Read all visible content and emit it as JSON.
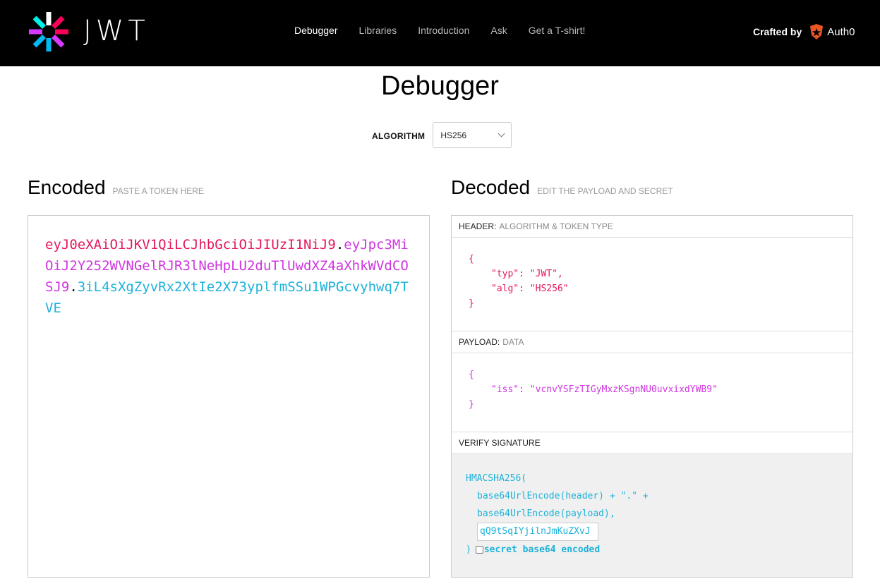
{
  "brand": {
    "logo_text": "JWT"
  },
  "nav": {
    "items": [
      {
        "label": "Debugger",
        "active": true
      },
      {
        "label": "Libraries"
      },
      {
        "label": "Introduction"
      },
      {
        "label": "Ask"
      },
      {
        "label": "Get a T-shirt!"
      }
    ]
  },
  "crafted": {
    "label": "Crafted by",
    "brand": "Auth0",
    "icon": "auth0-shield-icon"
  },
  "page": {
    "title": "Debugger"
  },
  "algorithm": {
    "label": "ALGORITHM",
    "value": "HS256"
  },
  "encoded": {
    "title": "Encoded",
    "subtitle": "PASTE A TOKEN HERE",
    "token_header": "eyJ0eXAiOiJKV1QiLCJhbGciOiJIUzI1NiJ9",
    "token_payload": "eyJpc3MiOiJ2Y252WVNGelRJR3lNeHpLU2duTlUwdXZ4aXhkWVdCOSJ9",
    "token_signature": "3iL4sXgZyvRx2XtIe2X73yplfmSSu1WPGcvyhwq7TVE",
    "dot": "."
  },
  "decoded": {
    "title": "Decoded",
    "subtitle": "EDIT THE PAYLOAD AND SECRET",
    "header_panel": {
      "label": "HEADER:",
      "sub": "ALGORITHM & TOKEN TYPE",
      "typ": "\"typ\": \"JWT\",",
      "alg": "\"alg\": \"HS256\""
    },
    "payload_panel": {
      "label": "PAYLOAD:",
      "sub": "DATA",
      "iss": "\"iss\": \"vcnvYSFzTIGyMxzKSgnNU0uvxixdYWB9\""
    },
    "verify_panel": {
      "label": "VERIFY SIGNATURE",
      "fn": "HMACSHA256(",
      "line1": "base64UrlEncode(header) + \".\" +",
      "line2": "base64UrlEncode(payload),",
      "secret": "qQ9tSqIYjilnJmKuZXvJ",
      "close": ")",
      "b64_label": "secret base64 encoded",
      "b64_checked": false
    },
    "brace_open": "{",
    "brace_close": "}"
  },
  "colors": {
    "header": "#e2175c",
    "payload": "#cf35e0",
    "signature": "#1cb2d8"
  }
}
